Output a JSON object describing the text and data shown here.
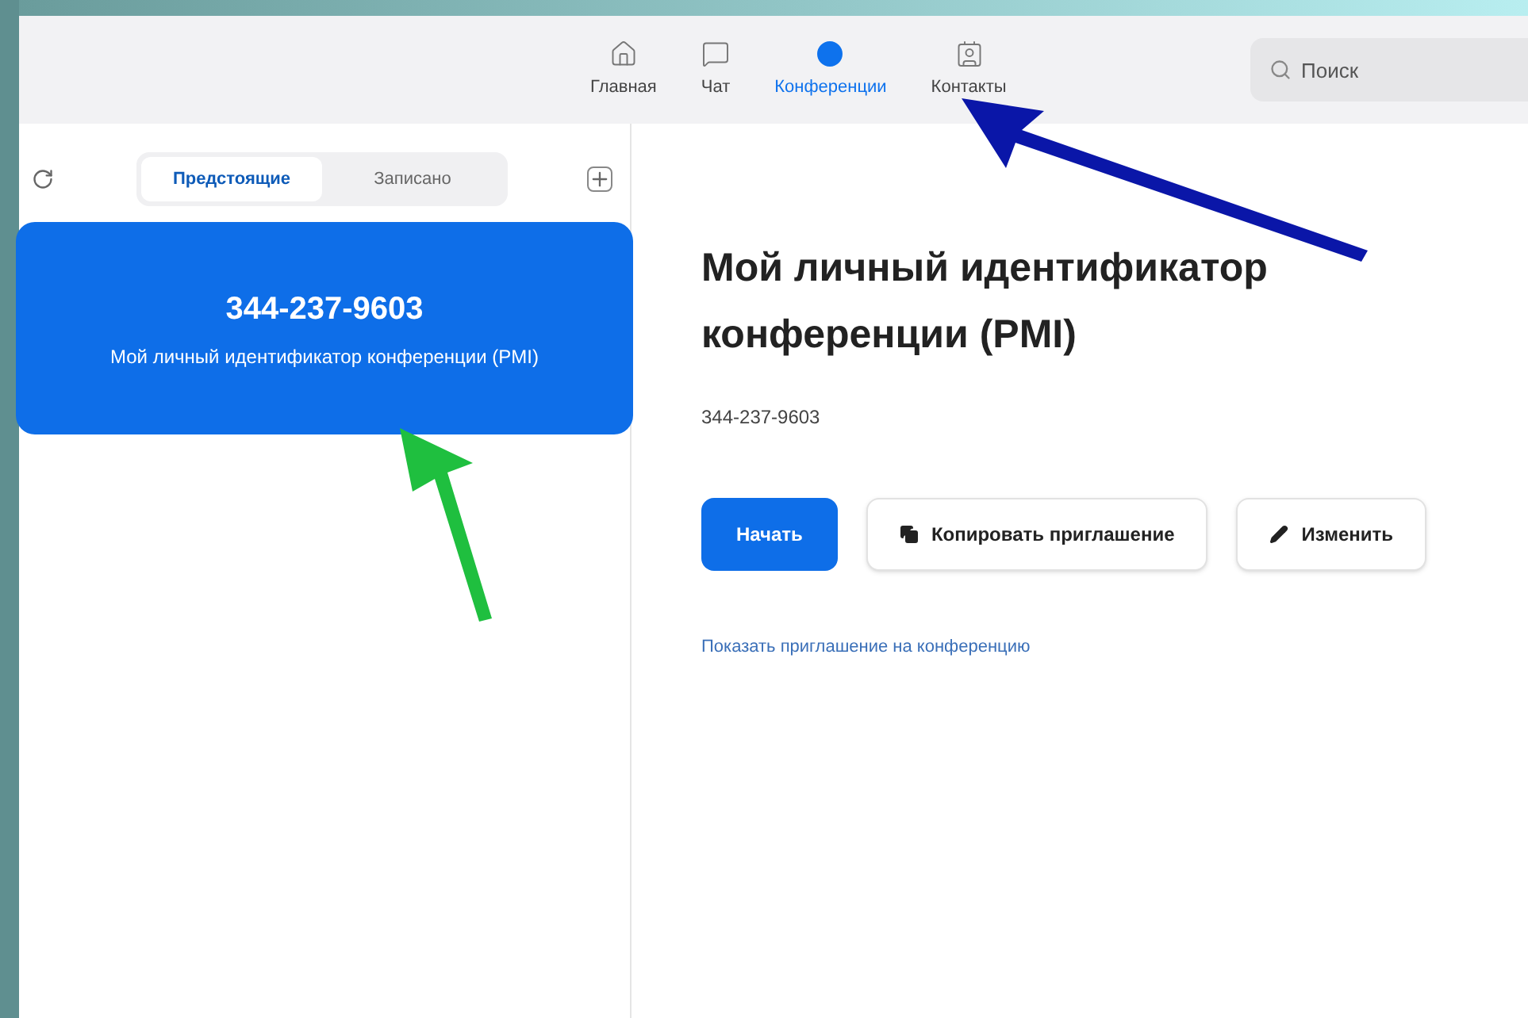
{
  "nav": [
    {
      "label": "Главная",
      "kind": "home",
      "selected": false
    },
    {
      "label": "Чат",
      "kind": "chat",
      "selected": false
    },
    {
      "label": "Конференции",
      "kind": "meetings",
      "selected": true
    },
    {
      "label": "Контакты",
      "kind": "contacts",
      "selected": false
    }
  ],
  "search": {
    "placeholder": "Поиск"
  },
  "meeting_tabs": [
    {
      "label": "Предстоящие",
      "selected": true
    },
    {
      "label": "Записано",
      "selected": false
    }
  ],
  "meeting_card": {
    "id": "344-237-9603",
    "title": "Мой личный идентификатор конференции (PMI)",
    "selected": true
  },
  "detail": {
    "title": "Мой личный идентификатор конференции (PMI)",
    "id": "344-237-9603",
    "buttons": [
      {
        "label": "Начать",
        "kind": "primary"
      },
      {
        "label": "Копировать приглашение",
        "kind": "copy"
      },
      {
        "label": "Изменить",
        "kind": "edit"
      }
    ],
    "link": "Показать приглашение на конференцию"
  }
}
